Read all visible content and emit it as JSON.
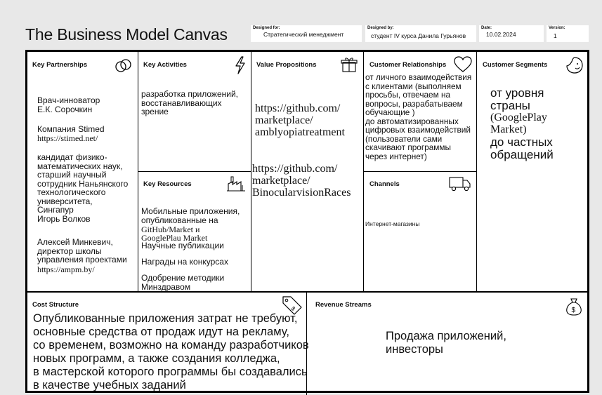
{
  "title": "The Business Model Canvas",
  "meta": {
    "designed_for": {
      "label": "Designed for:",
      "value": "Стратегический менеджмент"
    },
    "designed_by": {
      "label": "Designed by:",
      "value": "студент IV курса Данила Гурьянов"
    },
    "date": {
      "label": "Date:",
      "value": "10.02.2024"
    },
    "version": {
      "label": "Version:",
      "value": "1"
    }
  },
  "blocks": {
    "key_partnerships": {
      "heading": "Key Partnerships",
      "p1": "Врач-инноватор\nЕ.К. Сорочкин",
      "p2a": "Компания Stimed",
      "p2b": "https://stimed.net/",
      "p3": "кандидат физико-\nматематических наук,\nстарший научный\nсотрудник Наньянского\nтехнологического\nуниверситета,\nСингапур\nИгорь Волков",
      "p4": "Алексей Минкевич,\nдиректор школы\nуправления проектами",
      "p4b": "https://ampm.by/"
    },
    "key_activities": {
      "heading": "Key Activities",
      "text": "разработка приложений,\nвосстанавливающих\nзрение"
    },
    "key_resources": {
      "heading": "Key Resources",
      "r1": "Мобильные приложения,\nопубликованные на",
      "r1b": "GitHub/Market и\nGooglePlau Market",
      "r2": "Научные публикации",
      "r3": "Награды на конкурсах",
      "r4": "Одобрение методики\nМинздравом"
    },
    "value_propositions": {
      "heading": "Value Propositions",
      "link1": "https://github.com/\nmarketplace/\namblyopiatreatment",
      "link2": "https://github.com/\nmarketplace/\nBinocularvisionRaces"
    },
    "customer_relationships": {
      "heading": "Customer Relationships",
      "text": "от личного взаимодействия\nс клиентами (выполняем\nпросьбы, отвечаем на\nвопросы, разрабатываем\nобучающие )\nдо автоматизированных\nцифровых взаимодействий\n(пользователи сами\nскачивают программы\nчерез интернет)"
    },
    "channels": {
      "heading": "Channels",
      "text": "Интернет-магазины"
    },
    "customer_segments": {
      "heading": "Customer Segments",
      "t1": "от уровня\nстраны",
      "t2": "(GooglePlay\nMarket)",
      "t3": "до частных\nобращений"
    },
    "cost_structure": {
      "heading": "Cost Structure",
      "text": "Опубликованные приложения затрат не требуют,\nосновные средства от продаж идут на рекламу,\nсо временем, возможно на команду разработчиков\nновых программ, а также создания колледжа,\nв мастерской которого программы бы создавались\nв качестве учебных заданий"
    },
    "revenue_streams": {
      "heading": "Revenue Streams",
      "text": "Продажа приложений,\nинвесторы"
    }
  }
}
